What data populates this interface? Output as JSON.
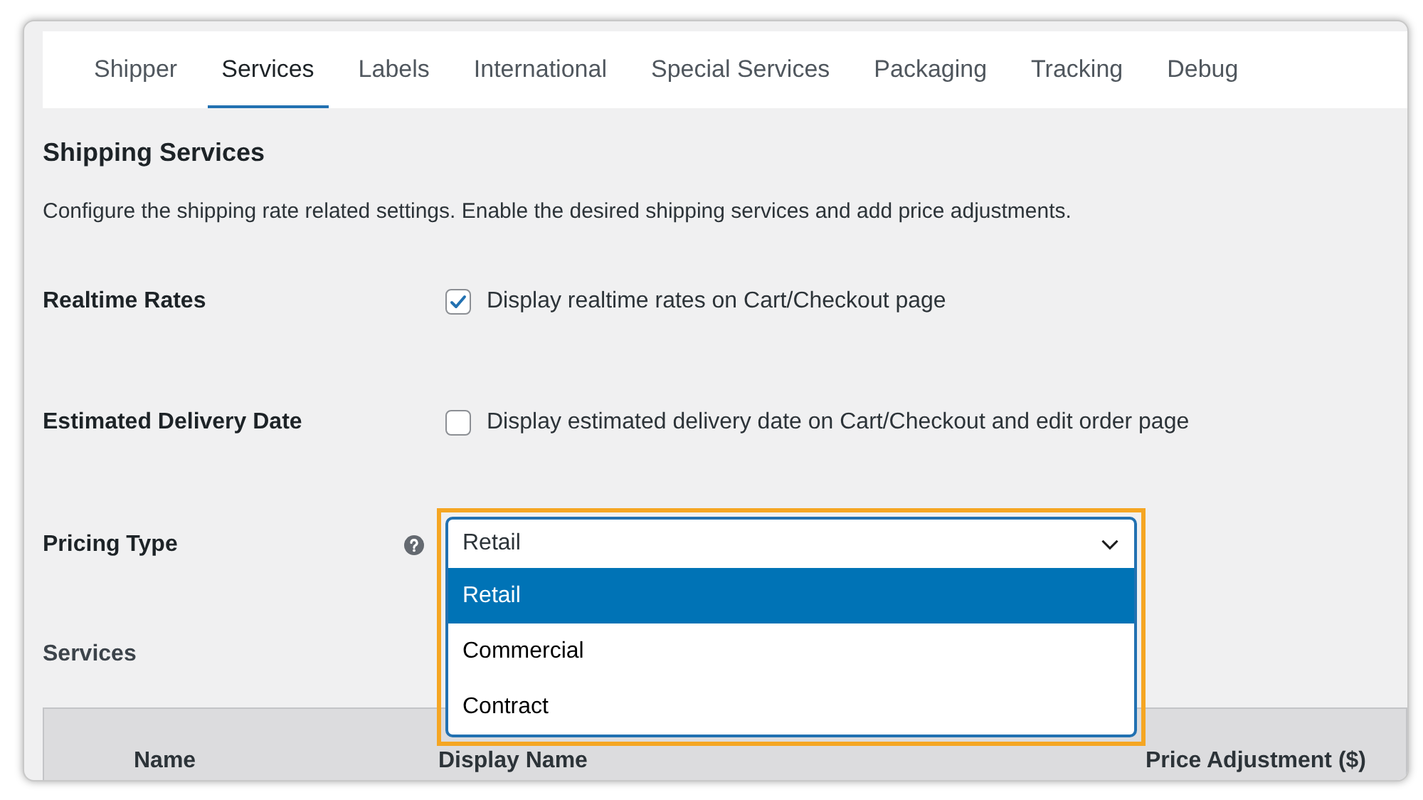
{
  "tabs": [
    {
      "label": "Shipper",
      "selected": false
    },
    {
      "label": "Services",
      "selected": true
    },
    {
      "label": "Labels",
      "selected": false
    },
    {
      "label": "International",
      "selected": false
    },
    {
      "label": "Special Services",
      "selected": false
    },
    {
      "label": "Packaging",
      "selected": false
    },
    {
      "label": "Tracking",
      "selected": false
    },
    {
      "label": "Debug",
      "selected": false
    }
  ],
  "heading": "Shipping Services",
  "description": "Configure the shipping rate related settings. Enable the desired shipping services and add price adjustments.",
  "settings": [
    {
      "kind": "checkbox",
      "label": "Realtime Rates",
      "text": "Display realtime rates on Cart/Checkout page",
      "checked": true
    },
    {
      "kind": "checkbox",
      "label": "Estimated Delivery Date",
      "text": "Display estimated delivery date on Cart/Checkout and edit order page",
      "checked": false
    },
    {
      "kind": "select",
      "label": "Pricing Type",
      "value": "Retail",
      "expanded": true,
      "options": [
        {
          "label": "Retail",
          "selected": true
        },
        {
          "label": "Commercial",
          "selected": false
        },
        {
          "label": "Contract",
          "selected": false
        }
      ]
    }
  ],
  "services": {
    "title": "Services",
    "columns": [
      "Name",
      "Display Name",
      "Price Adjustment ($)"
    ]
  }
}
